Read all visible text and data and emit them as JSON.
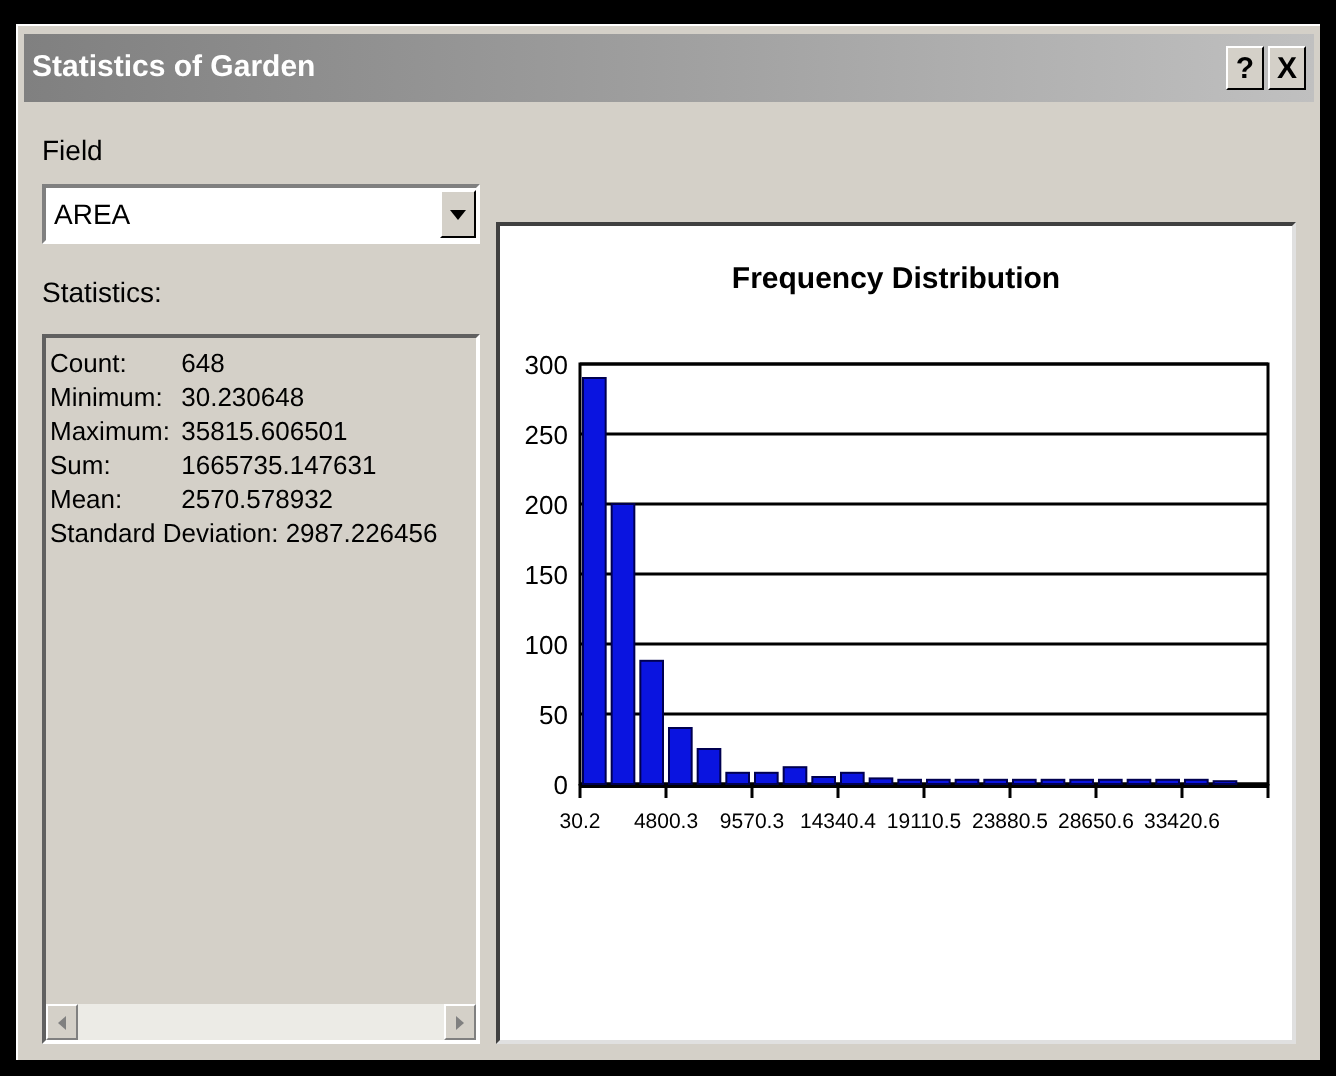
{
  "window": {
    "title": "Statistics of Garden",
    "buttons": [
      "?",
      "X"
    ]
  },
  "field": {
    "label": "Field",
    "value": "AREA"
  },
  "statistics": {
    "label": "Statistics:",
    "lines": [
      {
        "name": "Count:",
        "value": "648"
      },
      {
        "name": "Minimum:",
        "value": "30.230648"
      },
      {
        "name": "Maximum:",
        "value": "35815.606501"
      },
      {
        "name": "Sum:",
        "value": "1665735.147631"
      },
      {
        "name": "Mean:",
        "value": "2570.578932"
      },
      {
        "name": "Standard Deviation:",
        "value": "2987.226456"
      }
    ]
  },
  "chart": {
    "chart_data": {
      "type": "bar",
      "title": "Frequency Distribution",
      "x": [
        825.2,
        2415.2,
        4005.2,
        5595.2,
        7185.2,
        8775.2,
        10365.2,
        11955.2,
        13545.2,
        15135.2,
        16725.2,
        18315.2,
        19905.2,
        21495.2,
        23085.2,
        24675.2,
        26265.2,
        27855.2,
        29445.2,
        31035.2,
        32625.2,
        34215.2,
        35805.2
      ],
      "values": [
        290,
        200,
        88,
        40,
        25,
        8,
        8,
        12,
        5,
        8,
        4,
        3,
        3,
        3,
        3,
        3,
        3,
        3,
        3,
        3,
        3,
        3,
        2
      ],
      "xlim": [
        30.2,
        38190.8
      ],
      "grid": true,
      "ylim": [
        0,
        300
      ],
      "yticks": [
        0,
        50,
        100,
        150,
        200,
        250,
        300
      ],
      "xticks": [
        30.2,
        4800.3,
        9570.3,
        14340.4,
        19110.5,
        23880.5,
        28650.6,
        33420.6
      ]
    }
  }
}
